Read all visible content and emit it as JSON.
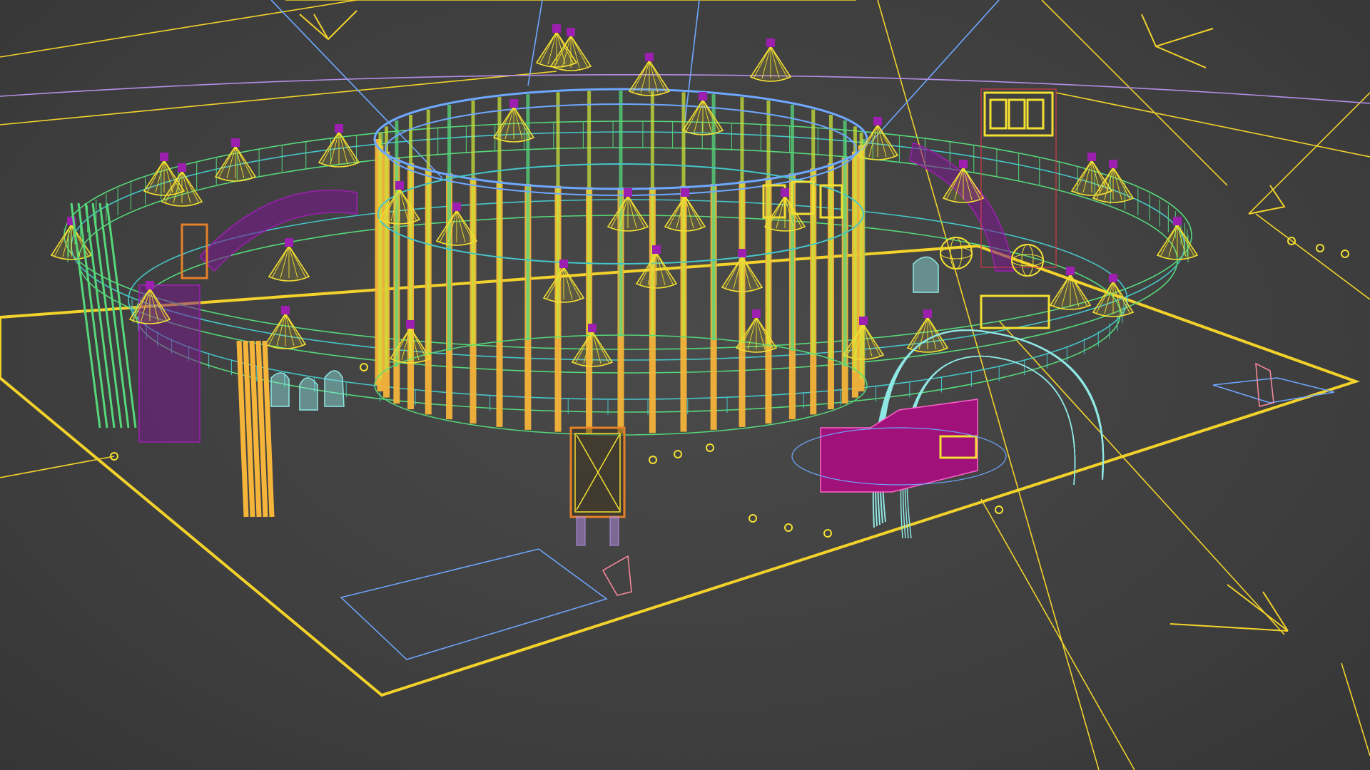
{
  "viewport": {
    "background": "#444444",
    "view": "perspective",
    "render_mode": "wireframe"
  },
  "colors": {
    "ground_outline": "#f2d22b",
    "cylinder_bars": "#f5b43a",
    "ring_green": "#56d87a",
    "ring_teal": "#46c6c8",
    "spotlight": "#f4e032",
    "purple_panel": "#9c1fb0",
    "magenta_counter": "#a0127a",
    "arch": "#8fe8e4",
    "camera_lines": "#f2d22b",
    "blue_lines": "#6ea8ff",
    "lilac_lines": "#b48ee6",
    "red_lines": "#d2394a"
  },
  "objects": {
    "spotlight_count": 34,
    "cylinder_bar_count": 48,
    "light_dot_count": 12
  },
  "icons": {
    "camera": "camera-icon",
    "spotlight": "spotlight-icon",
    "light_bulb": "bulb-icon"
  }
}
